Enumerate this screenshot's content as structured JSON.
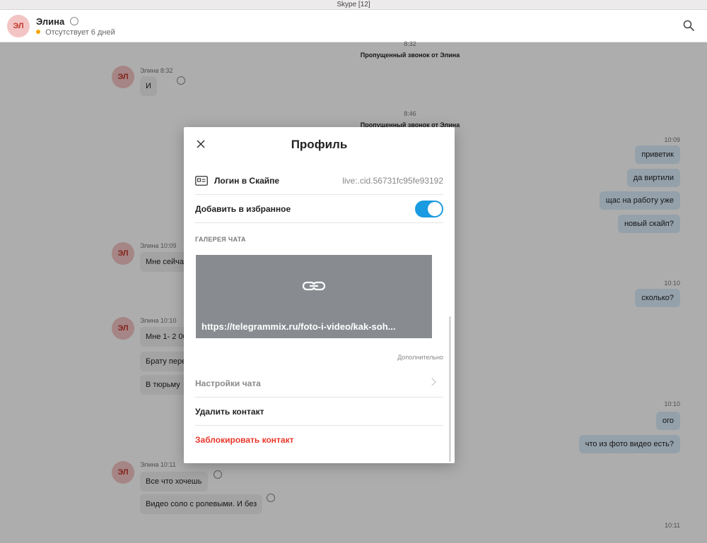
{
  "window": {
    "title": "Skype [12]"
  },
  "header": {
    "avatar_initials": "ЭЛ",
    "name": "Элина",
    "status": "Отсутствует 6 дней"
  },
  "feed": {
    "calls": [
      {
        "time": "8:32",
        "text": "Пропущенный звонок от Элина"
      },
      {
        "time": "8:46",
        "text": "Пропущенный звонок от Элина"
      }
    ],
    "incoming": [
      {
        "initials": "ЭЛ",
        "meta": "Элина 8:32",
        "messages": [
          "И"
        ]
      },
      {
        "initials": "ЭЛ",
        "meta": "Элина 10:09",
        "messages": [
          "Мне сейча"
        ]
      },
      {
        "initials": "ЭЛ",
        "meta": "Элина 10:10",
        "messages": [
          "Мне 1- 2 00",
          "Брату пере",
          "В тюрьму"
        ]
      },
      {
        "initials": "ЭЛ",
        "meta": "Элина 10:11",
        "messages": [
          "Все что хочешь",
          "Видео соло с ролевыми. И без"
        ]
      }
    ],
    "outgoing": [
      {
        "time": "10:09",
        "messages": [
          "приветик",
          "да виртили",
          "щас на работу уже",
          "новый скайп?"
        ]
      },
      {
        "time": "10:10",
        "messages": [
          "сколько?"
        ]
      },
      {
        "time": "10:10",
        "messages": [
          "ого",
          "что из фото видео есть?"
        ]
      },
      {
        "time": "10:11",
        "messages": []
      }
    ]
  },
  "modal": {
    "title": "Профиль",
    "skype_login_label": "Логин в Скайпе",
    "skype_login_value": "live:.cid.56731fc95fe93192",
    "favorites_label": "Добавить в избранное",
    "favorites_on": true,
    "gallery_title": "ГАЛЕРЕЯ ЧАТА",
    "gallery_url": "https://telegrammix.ru/foto-i-video/kak-soh...",
    "more_label": "Дополнительно",
    "chat_settings_label": "Настройки чата",
    "delete_contact_label": "Удалить контакт",
    "block_contact_label": "Заблокировать контакт",
    "colors": {
      "accent": "#1a9ae0",
      "danger": "#e8372c"
    }
  }
}
